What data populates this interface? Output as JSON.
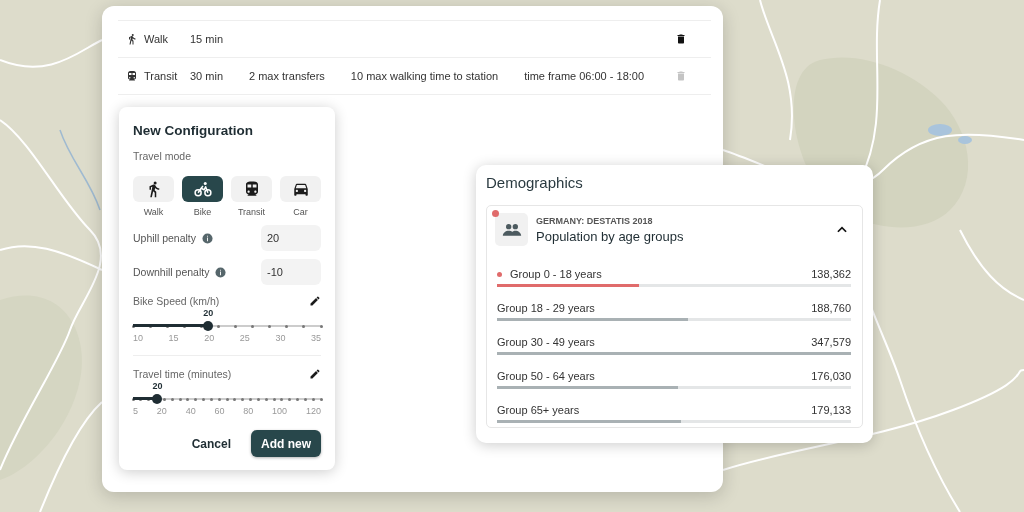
{
  "routes": [
    {
      "kind": "walk",
      "mode": "Walk",
      "details": [
        "15 min"
      ],
      "delete_disabled": false
    },
    {
      "kind": "transit",
      "mode": "Transit",
      "details": [
        "30 min",
        "2 max transfers",
        "10 max walking time to station",
        "time frame 06:00 - 18:00"
      ],
      "delete_disabled": true
    }
  ],
  "config": {
    "title": "New Configuration",
    "travel_mode_label": "Travel mode",
    "modes": [
      {
        "kind": "walk",
        "label": "Walk",
        "selected": false
      },
      {
        "kind": "bike",
        "label": "Bike",
        "selected": true
      },
      {
        "kind": "transit",
        "label": "Transit",
        "selected": false
      },
      {
        "kind": "car",
        "label": "Car",
        "selected": false
      }
    ],
    "fields": [
      {
        "label": "Uphill penalty",
        "value": "20"
      },
      {
        "label": "Downhill penalty",
        "value": "-10"
      }
    ],
    "sliders": [
      {
        "label": "Bike Speed (km/h)",
        "value": "20",
        "level": 0.4,
        "ticks": [
          "10",
          "15",
          "20",
          "25",
          "30",
          "35"
        ]
      },
      {
        "label": "Travel time (minutes)",
        "value": "20",
        "level": 0.13,
        "ticks": [
          "5",
          "20",
          "40",
          "60",
          "80",
          "100",
          "120"
        ]
      }
    ],
    "buttons": [
      {
        "kind": "text",
        "label": "Cancel"
      },
      {
        "kind": "primary",
        "label": "Add new"
      }
    ]
  },
  "demographics": {
    "title": "Demographics",
    "source": "GERMANY: DESTATIS 2018",
    "name": "Population by age groups",
    "marked": true,
    "expanded": true,
    "groups": [
      {
        "label": "Group 0 - 18 years",
        "value": "138,362",
        "level": 0.4,
        "selected": true
      },
      {
        "label": "Group 18 - 29 years",
        "value": "188,760",
        "level": 0.54,
        "selected": false
      },
      {
        "label": "Group 30 - 49 years",
        "value": "347,579",
        "level": 1.0,
        "selected": false
      },
      {
        "label": "Group 50 - 64 years",
        "value": "176,030",
        "level": 0.51,
        "selected": false
      },
      {
        "label": "Group 65+ years",
        "value": "179,133",
        "level": 0.52,
        "selected": false
      }
    ]
  }
}
